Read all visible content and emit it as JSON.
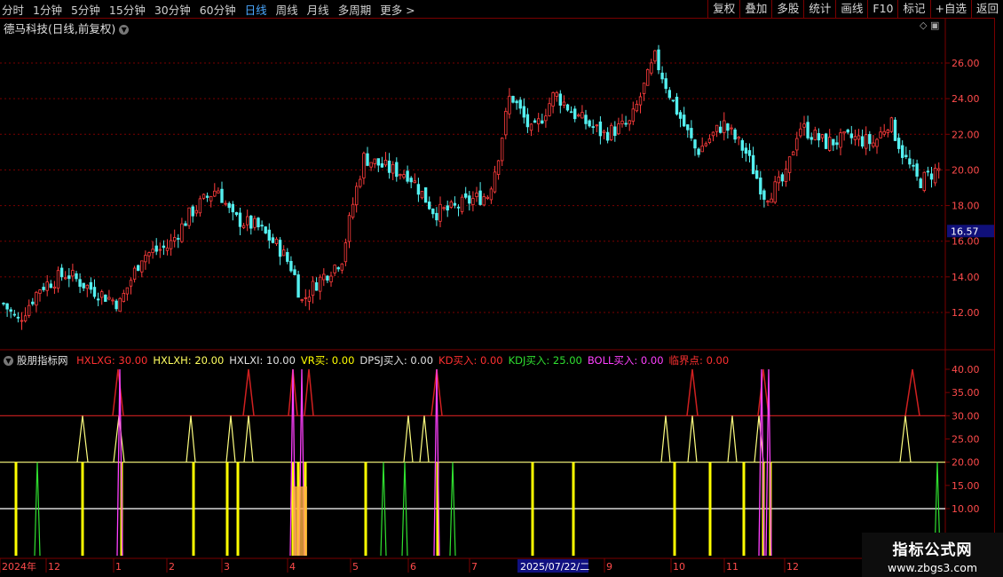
{
  "toolbar": {
    "periods": [
      "分时",
      "1分钟",
      "5分钟",
      "15分钟",
      "30分钟",
      "60分钟",
      "日线",
      "周线",
      "月线",
      "多周期",
      "更多 >"
    ],
    "active_index": 6,
    "actions": [
      "复权",
      "叠加",
      "多股",
      "统计",
      "画线",
      "F10",
      "标记",
      "+自选",
      "返回"
    ]
  },
  "stock_title": "德马科技(日线,前复权)",
  "price_axis": [
    "26.00",
    "24.00",
    "22.00",
    "20.00",
    "18.00",
    "16.00",
    "14.00",
    "12.00"
  ],
  "current_price_label": "16.57",
  "indicator": {
    "name": "股朋指标网",
    "items": [
      {
        "label": "HXLXG: 30.00",
        "color": "#ff3030"
      },
      {
        "label": "HXLXH: 20.00",
        "color": "#ffff60"
      },
      {
        "label": "HXLXI: 10.00",
        "color": "#e0e0e0"
      },
      {
        "label": "VR买: 0.00",
        "color": "#ffff00"
      },
      {
        "label": "DPSJ买入: 0.00",
        "color": "#e0e0e0"
      },
      {
        "label": "KD买入: 0.00",
        "color": "#ff3030"
      },
      {
        "label": "KDJ买入: 25.00",
        "color": "#30e030"
      },
      {
        "label": "BOLL买入: 0.00",
        "color": "#ff40ff"
      },
      {
        "label": "临界点: 0.00",
        "color": "#ff3030"
      }
    ]
  },
  "indicator_axis": [
    "40.00",
    "35.00",
    "30.00",
    "25.00",
    "20.00",
    "15.00",
    "10.00"
  ],
  "date_axis": {
    "labels": [
      "2024年",
      "12",
      "1",
      "2",
      "3",
      "4",
      "5",
      "6",
      "7",
      "9",
      "10",
      "11",
      "12"
    ],
    "highlight": "2025/07/22/二"
  },
  "watermark": {
    "title": "指标公式网",
    "url": "www.zbgs3.com"
  },
  "colors": {
    "up": "#ff3c3c",
    "down": "#54f0f0",
    "grid": "#7a0000",
    "axis_text": "#ff4b4b"
  }
}
